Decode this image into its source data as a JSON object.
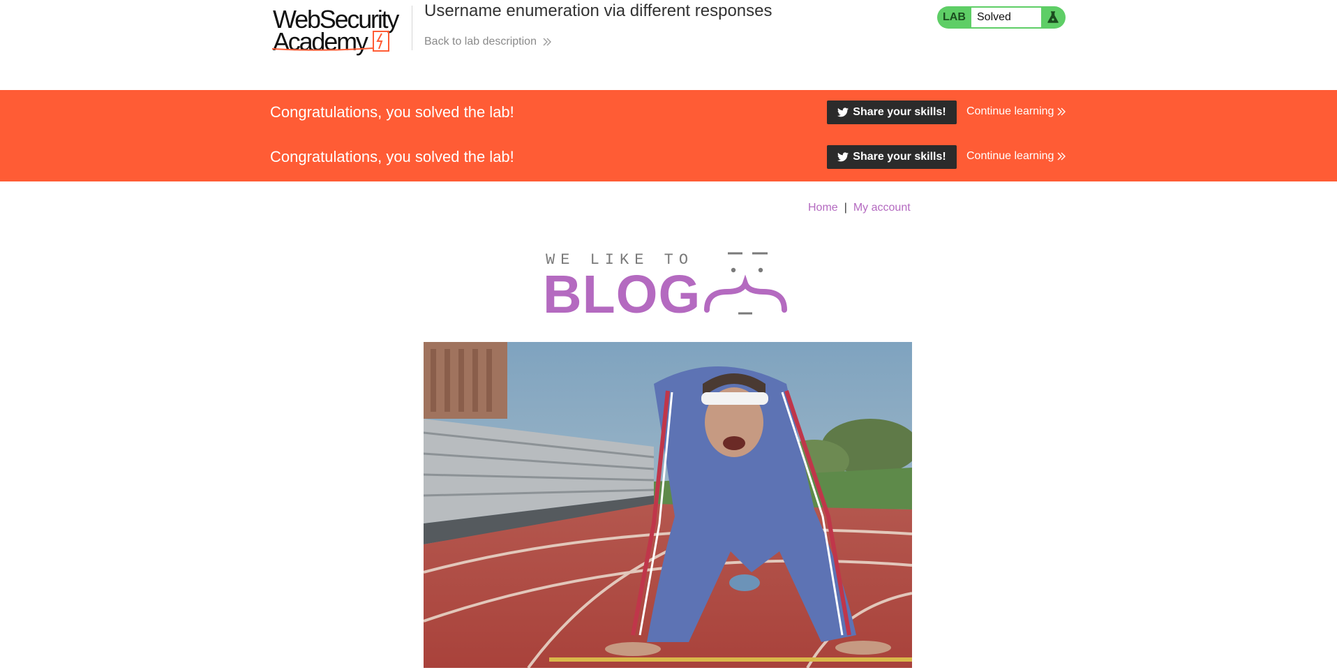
{
  "academy": {
    "logo_line1": "WebSecurity",
    "logo_line2": "Academy",
    "lab_title": "Username enumeration via different responses",
    "back_link": "Back to lab description",
    "status": {
      "label": "LAB",
      "value": "Solved"
    }
  },
  "notification": {
    "rows": [
      {
        "message": "Congratulations, you solved the lab!",
        "share_label": "Share your skills!",
        "continue_label": "Continue learning"
      },
      {
        "message": "Congratulations, you solved the lab!",
        "share_label": "Share your skills!",
        "continue_label": "Continue learning"
      }
    ]
  },
  "nav": {
    "home": "Home",
    "separator": "|",
    "account": "My account"
  },
  "blog": {
    "tagline": "WE LIKE TO",
    "word": "BLOG"
  },
  "hero": {
    "alt": "athlete-on-running-track"
  },
  "colors": {
    "brand_orange": "#ff5c35",
    "lab_green": "#5ece66",
    "blog_purple": "#b46ac0",
    "dark_button": "#2b2b2b"
  }
}
